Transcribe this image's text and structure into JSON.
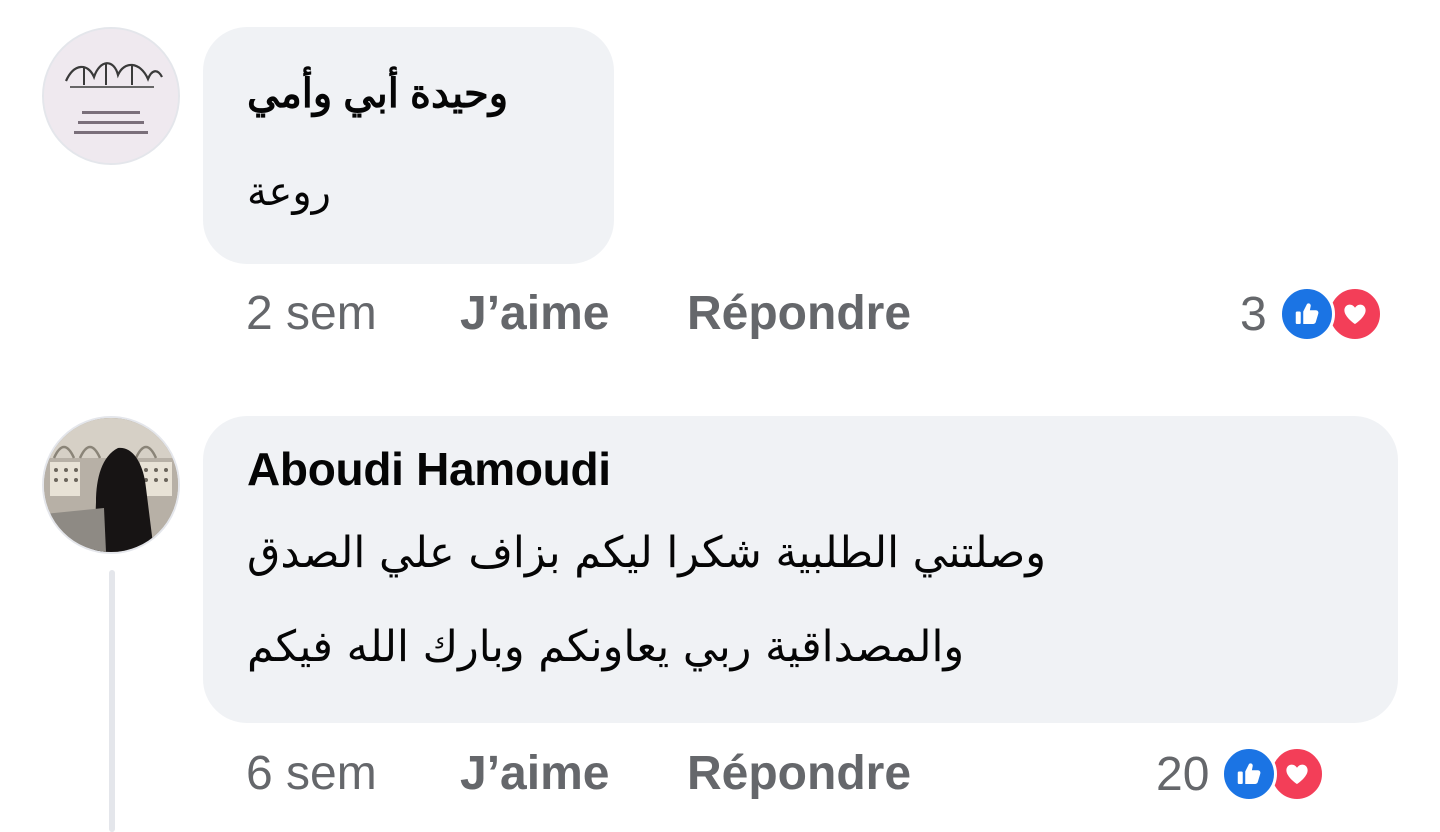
{
  "comments": [
    {
      "author": "وحيدة أبي وأمي",
      "text": "روعة",
      "avatar_icon": "calligraphy-avatar",
      "time": "2 sem",
      "like_label": "J’aime",
      "reply_label": "Répondre",
      "reaction_count": "3",
      "reactions": [
        "like",
        "love"
      ]
    },
    {
      "author": "Aboudi Hamoudi",
      "text_lines": [
        "وصلتني الطلبية شكرا ليكم بزاف علي الصدق",
        "والمصداقية ربي يعاونكم وبارك الله فيكم"
      ],
      "avatar_icon": "mosque-photo-avatar",
      "time": "6 sem",
      "like_label": "J’aime",
      "reply_label": "Répondre",
      "reaction_count": "20",
      "reactions": [
        "like",
        "love"
      ]
    }
  ],
  "colors": {
    "bubble": "#f0f2f5",
    "meta_text": "#65676b",
    "like": "#1b74e4",
    "love": "#f33e58"
  }
}
